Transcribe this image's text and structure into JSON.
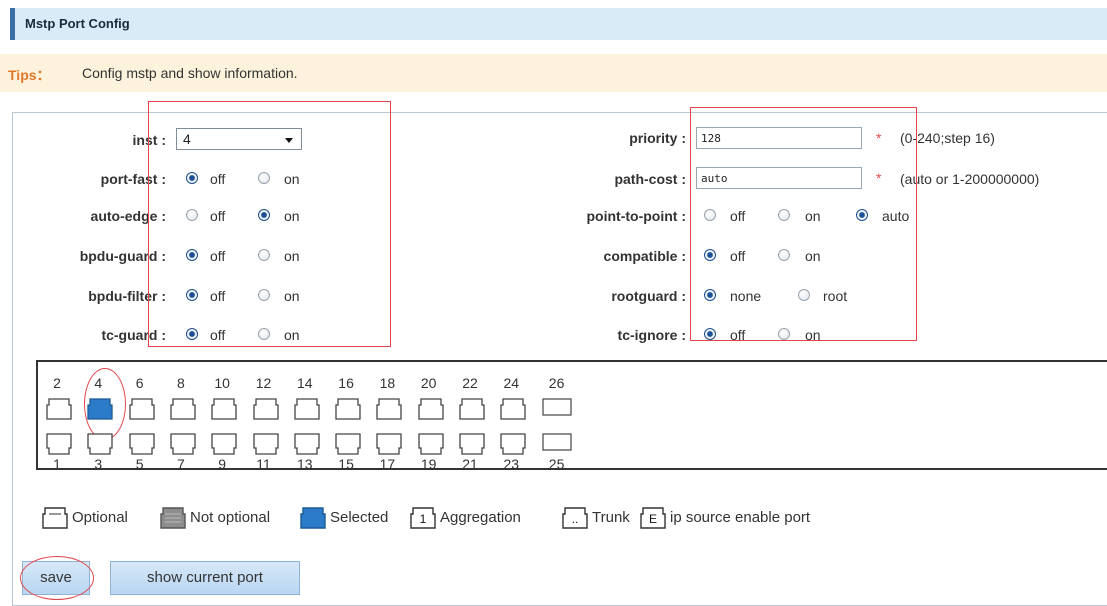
{
  "page": {
    "title": "Mstp Port Config",
    "tips_label": "Tips：",
    "tips_text": "Config mstp and show information."
  },
  "form_left": {
    "inst": {
      "label": "inst :",
      "value": "4"
    },
    "rows": [
      {
        "label": "port-fast :",
        "off": "off",
        "on": "on",
        "selected": "off"
      },
      {
        "label": "auto-edge :",
        "off": "off",
        "on": "on",
        "selected": "on"
      },
      {
        "label": "bpdu-guard :",
        "off": "off",
        "on": "on",
        "selected": "off"
      },
      {
        "label": "bpdu-filter :",
        "off": "off",
        "on": "on",
        "selected": "off"
      },
      {
        "label": "tc-guard :",
        "off": "off",
        "on": "on",
        "selected": "off"
      }
    ]
  },
  "form_right": {
    "priority": {
      "label": "priority :",
      "value": "128",
      "required": "*",
      "hint": "(0-240;step 16)"
    },
    "path_cost": {
      "label": "path-cost :",
      "value": "auto",
      "required": "*",
      "hint": "(auto or 1-200000000)"
    },
    "point_to_point": {
      "label": "point-to-point :",
      "options": [
        "off",
        "on",
        "auto"
      ],
      "selected": "auto"
    },
    "compatible": {
      "label": "compatible :",
      "options": [
        "off",
        "on"
      ],
      "selected": "off"
    },
    "rootguard": {
      "label": "rootguard :",
      "options": [
        "none",
        "root"
      ],
      "selected": "none"
    },
    "tc_ignore": {
      "label": "tc-ignore :",
      "options": [
        "off",
        "on"
      ],
      "selected": "off"
    }
  },
  "ports": {
    "top_numbers": [
      "2",
      "4",
      "6",
      "8",
      "10",
      "12",
      "14",
      "16",
      "18",
      "20",
      "22",
      "24",
      "26"
    ],
    "bottom_numbers": [
      "1",
      "3",
      "5",
      "7",
      "9",
      "11",
      "13",
      "15",
      "17",
      "19",
      "21",
      "23",
      "25"
    ],
    "selected_port": "4"
  },
  "legend": {
    "optional": "Optional",
    "not_optional": "Not optional",
    "selected": "Selected",
    "aggregation": "Aggregation",
    "aggregation_icon_text": "1",
    "trunk": "Trunk",
    "trunk_icon_text": "..",
    "ip_source": "ip source enable port",
    "ip_source_icon_text": "E"
  },
  "buttons": {
    "save": "save",
    "show_current_port": "show current port"
  },
  "colors": {
    "title_bg": "#d9ebf7",
    "tips_bg": "#fdf3dc",
    "tips_label": "#e0782b",
    "selected_port": "#2b7bc8",
    "annotation_red": "#e0474c",
    "radio_checked": "#1a4f95"
  }
}
